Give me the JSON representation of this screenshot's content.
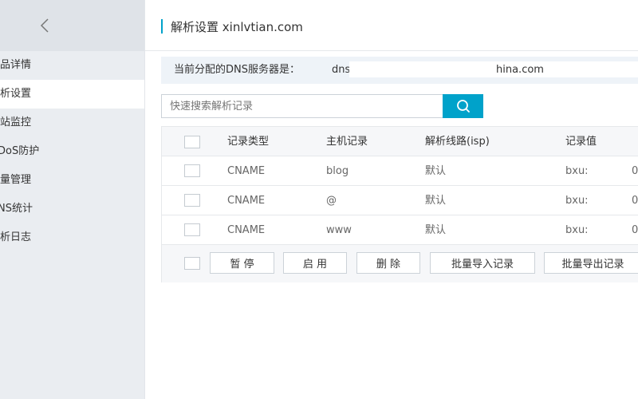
{
  "sidebar": {
    "back_label": "<",
    "items": [
      {
        "label": "产品详情"
      },
      {
        "label": "解析设置"
      },
      {
        "label": "网站监控"
      },
      {
        "label": "DDoS防护"
      },
      {
        "label": "流量管理"
      },
      {
        "label": "DNS统计"
      },
      {
        "label": "解析日志"
      }
    ]
  },
  "header": {
    "title": "解析设置 xinlvtian.com"
  },
  "notice": {
    "label": "当前分配的DNS服务器是：",
    "prefix": "dns",
    "suffix": "hina.com"
  },
  "search": {
    "placeholder": "快速搜索解析记录"
  },
  "table": {
    "columns": [
      "记录类型",
      "主机记录",
      "解析线路(isp)",
      "记录值",
      ""
    ],
    "rows": [
      {
        "type": "CNAME",
        "host": "blog",
        "line": "默认",
        "value": "bxu:",
        "extra": "0"
      },
      {
        "type": "CNAME",
        "host": "@",
        "line": "默认",
        "value": "bxu:",
        "extra": "0"
      },
      {
        "type": "CNAME",
        "host": "www",
        "line": "默认",
        "value": "bxu:",
        "extra": "0"
      }
    ]
  },
  "actions": {
    "pause": "暂 停",
    "enable": "启 用",
    "delete": "删 除",
    "import": "批量导入记录",
    "export": "批量导出记录"
  },
  "colors": {
    "accent": "#00a2ca",
    "sidebar_bg": "#eaedf1",
    "notice_bg": "#eef3f8"
  }
}
